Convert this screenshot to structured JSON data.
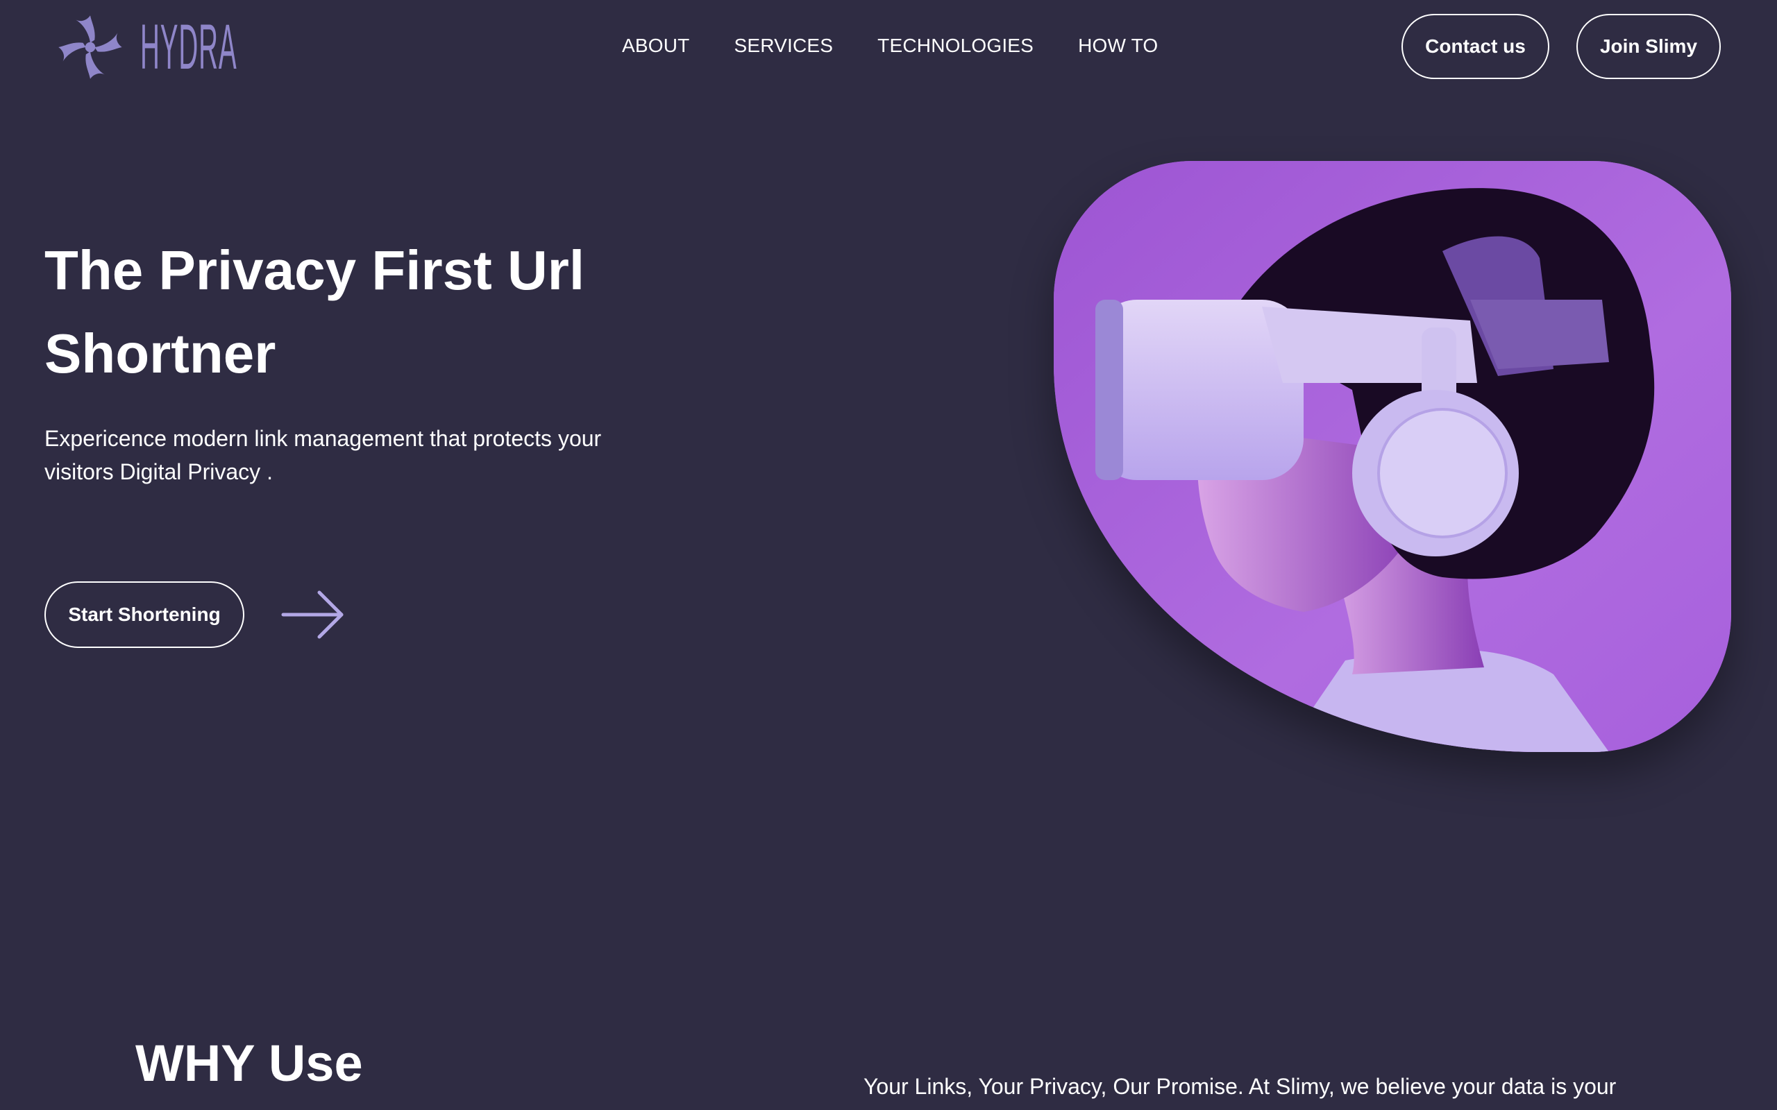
{
  "brand": {
    "logo_text": "HYDRA",
    "logo_icon": "swirl-cross-icon",
    "accent_color": "#8f86c9"
  },
  "nav": {
    "links": [
      "ABOUT",
      "SERVICES",
      "TECHNOLOGIES",
      "HOW TO"
    ]
  },
  "header_buttons": {
    "contact": "Contact us",
    "join": "Join Slimy"
  },
  "hero": {
    "title": "The Privacy First  Url Shortner",
    "subtitle": "Expericence modern link management that protects your visitors Digital Privacy .",
    "cta_label": "Start Shortening",
    "cta_icon": "arrow-right-icon",
    "image_description_color": "#a45ad6"
  },
  "why": {
    "title": "WHY Use",
    "text": "Your Links, Your Privacy, Our Promise. At Slimy, we believe your data is your"
  },
  "colors": {
    "background": "#2f2c43",
    "text": "#ffffff",
    "image_tint": "#a45ad6"
  }
}
